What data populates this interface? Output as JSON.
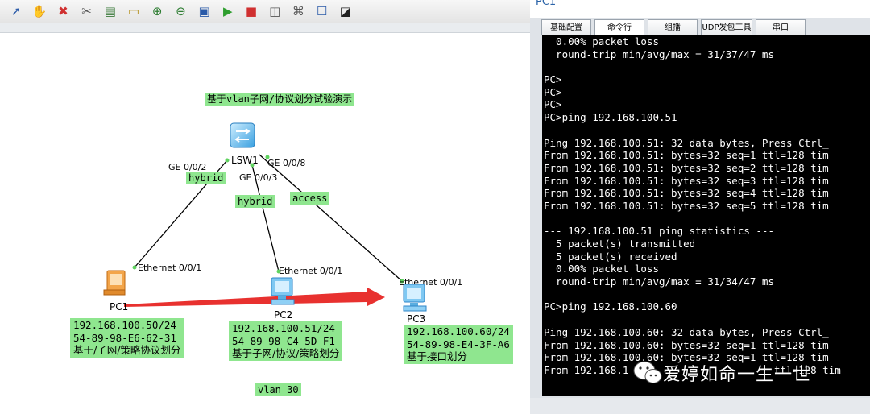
{
  "toolbar": {
    "buttons": [
      {
        "name": "select-pointer-icon",
        "glyph": "➚",
        "color": "#2a5aa8"
      },
      {
        "name": "hand-pan-icon",
        "glyph": "✋",
        "color": "#c48a2a"
      },
      {
        "name": "delete-icon",
        "glyph": "✖",
        "color": "#d03030"
      },
      {
        "name": "delete-link-icon",
        "glyph": "✂",
        "color": "#555555"
      },
      {
        "name": "text-annotation-icon",
        "glyph": "▤",
        "color": "#3a7a3a"
      },
      {
        "name": "rectangle-icon",
        "glyph": "▭",
        "color": "#b08a10"
      },
      {
        "name": "zoom-in-icon",
        "glyph": "⊕",
        "color": "#2e7d32"
      },
      {
        "name": "zoom-out-icon",
        "glyph": "⊖",
        "color": "#2e7d32"
      },
      {
        "name": "fit-view-icon",
        "glyph": "▣",
        "color": "#2a5aa8"
      },
      {
        "name": "start-device-icon",
        "glyph": "▶",
        "color": "#2e9e2e"
      },
      {
        "name": "stop-device-icon",
        "glyph": "■",
        "color": "#d03030"
      },
      {
        "name": "collect-data-icon",
        "glyph": "◫",
        "color": "#555555"
      },
      {
        "name": "topology-icon",
        "glyph": "⌘",
        "color": "#555555"
      },
      {
        "name": "interface-panel-icon",
        "glyph": "☐",
        "color": "#2a5aa8"
      },
      {
        "name": "capture-icon",
        "glyph": "◪",
        "color": "#222222"
      }
    ]
  },
  "topology": {
    "title": "基于vlan子网/协议划分试验演示",
    "switch": {
      "name": "LSW1"
    },
    "ports": {
      "lsw_ge002": "GE 0/0/2",
      "lsw_ge003": "GE 0/0/3",
      "lsw_ge008": "GE 0/0/8",
      "pc1_eth": "Ethernet 0/0/1",
      "pc2_eth": "Ethernet 0/0/1",
      "pc3_eth": "Ethernet 0/0/1"
    },
    "link_modes": {
      "pc1": "hybrid",
      "pc2": "hybrid",
      "pc3": "access"
    },
    "pcs": [
      {
        "name": "PC1",
        "ip": "192.168.100.50/24",
        "mac": "54-89-98-E6-62-31",
        "note": "基于/子网/策略协议划分"
      },
      {
        "name": "PC2",
        "ip": "192.168.100.51/24",
        "mac": "54-89-98-C4-5D-F1",
        "note": "基于子网/协议/策略划分"
      },
      {
        "name": "PC3",
        "ip": "192.168.100.60/24",
        "mac": "54-89-98-E4-3F-A6",
        "note": "基于接口划分"
      }
    ],
    "vlan_label": "vlan 30",
    "colors": {
      "label_bg": "#8fe68f",
      "arrow": "#e8312f",
      "link": "#000000",
      "port_dot": "#5fd35f"
    }
  },
  "window": {
    "title": "PC1",
    "tabs": [
      "基础配置",
      "命令行",
      "组播",
      "UDP发包工具",
      "串口"
    ],
    "active_tab": "命令行",
    "console_lines": [
      "  0.00% packet loss",
      "  round-trip min/avg/max = 31/37/47 ms",
      "",
      "PC>",
      "PC>",
      "PC>",
      "PC>ping 192.168.100.51",
      "",
      "Ping 192.168.100.51: 32 data bytes, Press Ctrl_",
      "From 192.168.100.51: bytes=32 seq=1 ttl=128 tim",
      "From 192.168.100.51: bytes=32 seq=2 ttl=128 tim",
      "From 192.168.100.51: bytes=32 seq=3 ttl=128 tim",
      "From 192.168.100.51: bytes=32 seq=4 ttl=128 tim",
      "From 192.168.100.51: bytes=32 seq=5 ttl=128 tim",
      "",
      "--- 192.168.100.51 ping statistics ---",
      "  5 packet(s) transmitted",
      "  5 packet(s) received",
      "  0.00% packet loss",
      "  round-trip min/avg/max = 31/34/47 ms",
      "",
      "PC>ping 192.168.100.60",
      "",
      "Ping 192.168.100.60: 32 data bytes, Press Ctrl_",
      "From 192.168.100.60: bytes=32 seq=1 ttl=128 tim",
      "From 192.168.100.60: bytes=32 seq=1 ttl=128 tim",
      "From 192.168.1                        ttl=128 tim"
    ]
  },
  "watermark": {
    "text": "爱婷如命一生一世",
    "icon": "wechat-icon"
  }
}
